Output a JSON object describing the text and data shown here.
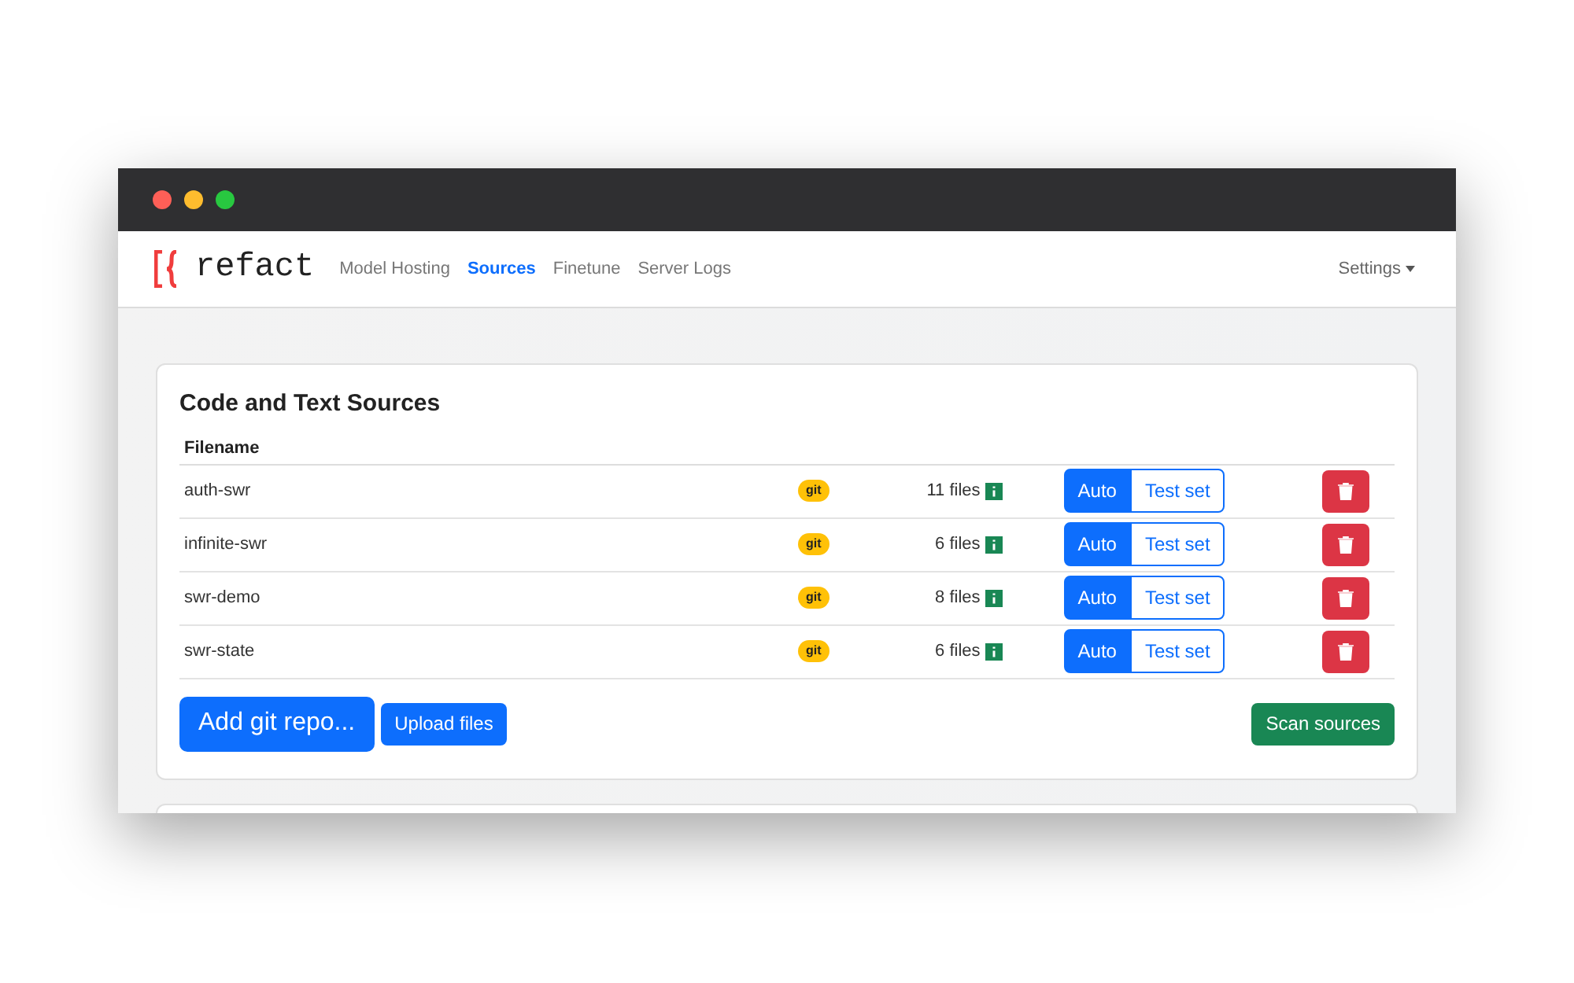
{
  "nav": {
    "brand": "refact",
    "links": [
      {
        "label": "Model Hosting",
        "selected": false
      },
      {
        "label": "Sources",
        "selected": true
      },
      {
        "label": "Finetune",
        "selected": false
      },
      {
        "label": "Server Logs",
        "selected": false
      }
    ],
    "settings": "Settings"
  },
  "card": {
    "title": "Code and Text Sources",
    "columns": [
      "Filename"
    ],
    "rows": [
      {
        "filename": "auth-swr",
        "tag": "git",
        "files": "11 files",
        "modes": [
          {
            "label": "Auto",
            "selected": true
          },
          {
            "label": "Test set",
            "selected": false
          }
        ]
      },
      {
        "filename": "infinite-swr",
        "tag": "git",
        "files": "6 files",
        "modes": [
          {
            "label": "Auto",
            "selected": true
          },
          {
            "label": "Test set",
            "selected": false
          }
        ]
      },
      {
        "filename": "swr-demo",
        "tag": "git",
        "files": "8 files",
        "modes": [
          {
            "label": "Auto",
            "selected": true
          },
          {
            "label": "Test set",
            "selected": false
          }
        ]
      },
      {
        "filename": "swr-state",
        "tag": "git",
        "files": "6 files",
        "modes": [
          {
            "label": "Auto",
            "selected": true
          },
          {
            "label": "Test set",
            "selected": false
          }
        ]
      }
    ],
    "buttons": {
      "add": "Add git repo...",
      "upload": "Upload files",
      "scan": "Scan sources"
    }
  }
}
